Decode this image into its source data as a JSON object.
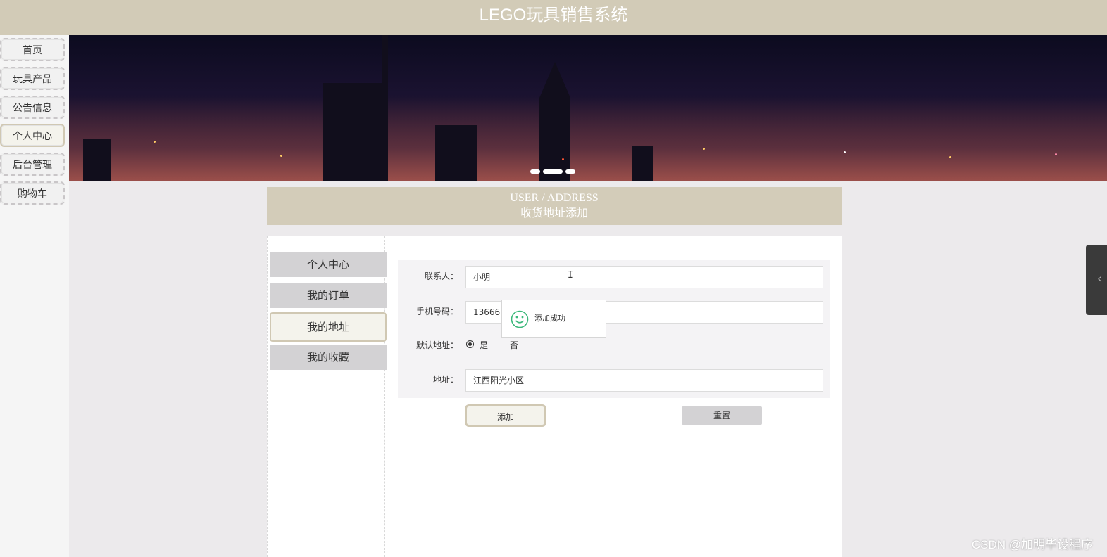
{
  "header": {
    "title": "LEGO玩具销售系统"
  },
  "leftnav": {
    "items": [
      {
        "label": "首页"
      },
      {
        "label": "玩具产品"
      },
      {
        "label": "公告信息"
      },
      {
        "label": "个人中心",
        "active": true
      },
      {
        "label": "后台管理"
      },
      {
        "label": "购物车"
      }
    ]
  },
  "banner": {
    "slide_count": 3,
    "active_slide": 2
  },
  "section": {
    "title_en": "USER / ADDRESS",
    "title_cn": "收货地址添加"
  },
  "submenu": {
    "items": [
      {
        "label": "个人中心"
      },
      {
        "label": "我的订单"
      },
      {
        "label": "我的地址",
        "active": true
      },
      {
        "label": "我的收藏"
      }
    ]
  },
  "form": {
    "contact_label": "联系人：",
    "contact_value": "小明",
    "phone_label": "手机号码：",
    "phone_value": "136665",
    "default_label": "默认地址：",
    "default_yes": "是",
    "default_no": "否",
    "default_selected": "是",
    "address_label": "地址：",
    "address_value": "江西阳光小区",
    "add_button": "添加",
    "reset_button": "重置"
  },
  "toast": {
    "message": "添加成功",
    "icon": "smile-icon",
    "color": "#3bb87a"
  },
  "watermark": "CSDN @加明毕设程序",
  "colors": {
    "header_bg": "#d2cbb7",
    "section_bg": "#d3ccb9",
    "active_border": "#d0c8b3"
  }
}
